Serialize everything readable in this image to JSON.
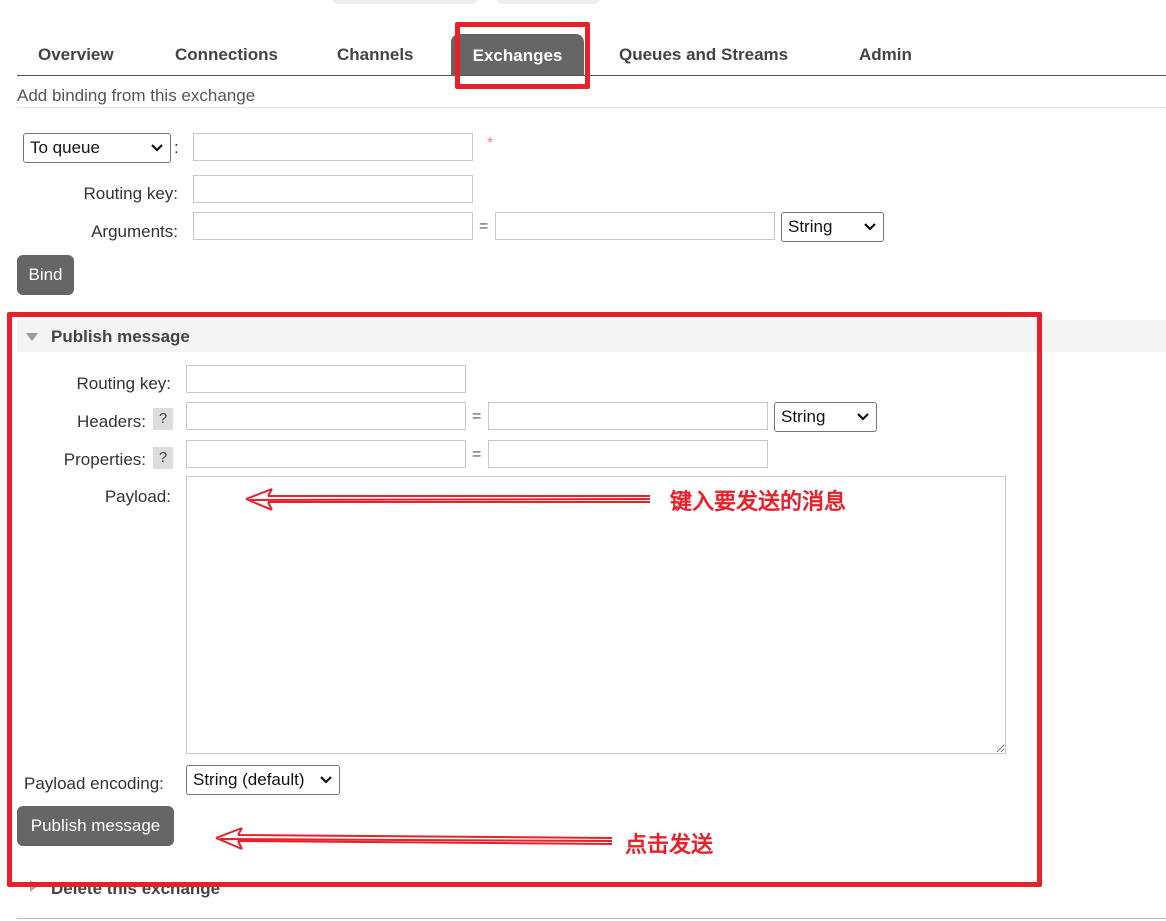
{
  "nav": {
    "items": [
      "Overview",
      "Connections",
      "Channels",
      "Exchanges",
      "Queues and Streams",
      "Admin"
    ],
    "active": "Exchanges"
  },
  "binding": {
    "heading": "Add binding from this exchange",
    "destination_type": "To queue",
    "routing_key_label": "Routing key:",
    "arguments_label": "Arguments:",
    "arg_type": "String",
    "bind_button": "Bind",
    "required_marker": "*",
    "colon": ":",
    "equals": "="
  },
  "publish": {
    "heading": "Publish message",
    "routing_key_label": "Routing key:",
    "headers_label": "Headers:",
    "properties_label": "Properties:",
    "help": "?",
    "header_type": "String",
    "payload_label": "Payload:",
    "payload_value": "",
    "encoding_label": "Payload encoding:",
    "encoding_value": "String (default)",
    "publish_button": "Publish message"
  },
  "delete_section": {
    "heading": "Delete this exchange"
  },
  "annotations": {
    "payload_hint": "键入要发送的消息",
    "publish_hint": "点击发送",
    "color": "#e8202a"
  }
}
